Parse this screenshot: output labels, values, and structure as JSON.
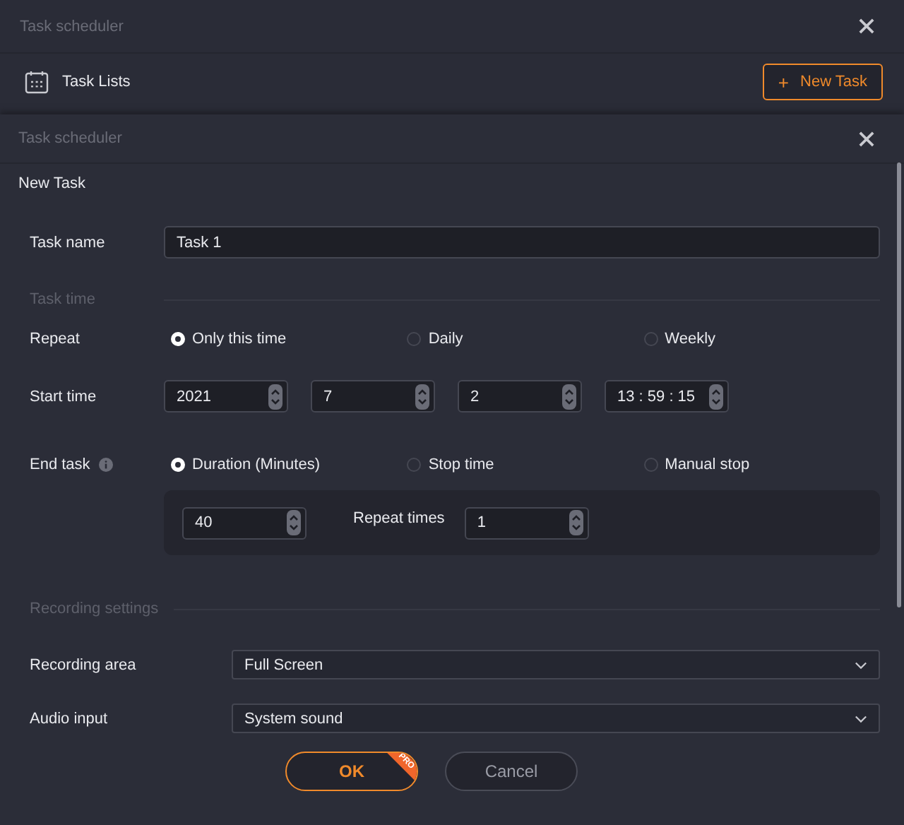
{
  "window": {
    "title": "Task scheduler"
  },
  "task_lists": {
    "title": "Task Lists",
    "new_task_button": {
      "icon": "+",
      "label": "New Task"
    }
  },
  "dialog": {
    "title": "Task scheduler",
    "heading": "New Task",
    "task_name": {
      "label": "Task name",
      "value": "Task 1"
    },
    "task_time_section": "Task time",
    "repeat": {
      "label": "Repeat",
      "options": [
        {
          "label": "Only this time",
          "selected": true
        },
        {
          "label": "Daily",
          "selected": false
        },
        {
          "label": "Weekly",
          "selected": false
        }
      ]
    },
    "start_time": {
      "label": "Start time",
      "fields": [
        "2021",
        "7",
        "2",
        "13 : 59 : 15"
      ]
    },
    "end_task": {
      "label": "End task",
      "options": [
        {
          "label": "Duration (Minutes)",
          "selected": true
        },
        {
          "label": "Stop time",
          "selected": false
        },
        {
          "label": "Manual stop",
          "selected": false
        }
      ],
      "duration": "40",
      "repeat_times": {
        "label": "Repeat times",
        "value": "1"
      }
    },
    "recording_section": "Recording settings",
    "recording_area": {
      "label": "Recording area",
      "value": "Full Screen"
    },
    "audio_input": {
      "label": "Audio input",
      "value": "System sound"
    },
    "buttons": {
      "ok": {
        "label": "OK",
        "badge": "PRO"
      },
      "cancel": {
        "label": "Cancel"
      }
    }
  }
}
